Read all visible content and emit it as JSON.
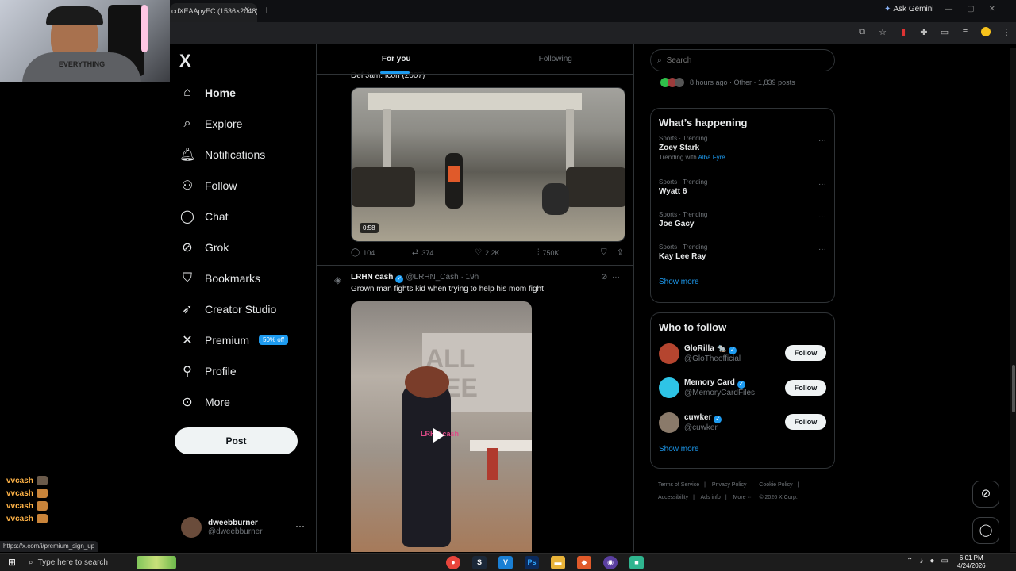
{
  "browser": {
    "tab_title": "cdXEAApyEC (1536×2048)",
    "tab_close": "×",
    "new_tab": "+",
    "ask_gemini": "Ask Gemini"
  },
  "webcam": {
    "shirt_text": "EVERYTHING"
  },
  "chat_overlay": {
    "lines": [
      "vvcash",
      "vvcash",
      "vvcash",
      "vvcash"
    ]
  },
  "status_url": "https://x.com/i/premium_sign_up",
  "nav": {
    "logo": "X",
    "items": [
      {
        "label": "Home",
        "icon": "home-icon"
      },
      {
        "label": "Explore",
        "icon": "search-icon"
      },
      {
        "label": "Notifications",
        "icon": "bell-icon"
      },
      {
        "label": "Follow",
        "icon": "add-person-icon"
      },
      {
        "label": "Chat",
        "icon": "chat-icon"
      },
      {
        "label": "Grok",
        "icon": "grok-icon"
      },
      {
        "label": "Bookmarks",
        "icon": "bookmark-icon"
      },
      {
        "label": "Creator Studio",
        "icon": "rocket-icon"
      },
      {
        "label": "Premium",
        "icon": "x-logo-icon"
      },
      {
        "label": "Profile",
        "icon": "person-icon"
      },
      {
        "label": "More",
        "icon": "more-circle-icon"
      }
    ],
    "premium_badge": "50% off",
    "post_button": "Post",
    "account": {
      "name": "dweebburner",
      "handle": "@dweebburner",
      "more": "···"
    }
  },
  "feed": {
    "tabs": [
      "For you",
      "Following"
    ],
    "prev_tweet_text": "Def Jam: Icon (2007)",
    "video_duration": "0:58",
    "actions": {
      "replies": "104",
      "reposts": "374",
      "likes": "2.2K",
      "views": "750K"
    },
    "tweet2": {
      "name": "LRHN cash",
      "handle": "@LRHN_Cash",
      "time": "· 19h",
      "text": "Grown man fights kid when trying to help his mom fight",
      "video_watermark": "LRHN cash",
      "wall_text": "ALL BEE"
    }
  },
  "sidebar": {
    "search_placeholder": "Search",
    "trend_meta": "8 hours ago · Other · 1,839 posts",
    "whats_happening": {
      "title": "What’s happening",
      "trends": [
        {
          "meta": "Sports · Trending",
          "topic": "Zoey Stark",
          "with_prefix": "Trending with",
          "with": "Alba Fyre"
        },
        {
          "meta": "Sports · Trending",
          "topic": "Wyatt 6"
        },
        {
          "meta": "Sports · Trending",
          "topic": "Joe Gacy"
        },
        {
          "meta": "Sports · Trending",
          "topic": "Kay Lee Ray"
        }
      ],
      "show_more": "Show more"
    },
    "who_to_follow": {
      "title": "Who to follow",
      "accounts": [
        {
          "name": "GloRilla 🐀",
          "handle": "@GloTheofficial",
          "avatar_color": "#b5452f"
        },
        {
          "name": "Memory Card",
          "handle": "@MemoryCardFiles",
          "avatar_color": "#2ec4e6"
        },
        {
          "name": "cuwker",
          "handle": "@cuwker",
          "avatar_color": "#8a7a6a"
        }
      ],
      "follow_label": "Follow",
      "show_more": "Show more"
    },
    "footer": [
      "Terms of Service",
      "|",
      "Privacy Policy",
      "|",
      "Cookie Policy",
      "|",
      "Accessibility",
      "|",
      "Ads info",
      "|",
      "More ···",
      "© 2026 X Corp."
    ]
  },
  "taskbar": {
    "search_text": "Type here to search",
    "time": "6:01 PM",
    "date": "4/24/2026",
    "apps": [
      {
        "name": "chrome-icon",
        "glyph": "●",
        "color": "#e8453c"
      },
      {
        "name": "steam-icon",
        "glyph": "S",
        "color": "#1b2838"
      },
      {
        "name": "vscode-icon",
        "glyph": "V",
        "color": "#1a7fd4"
      },
      {
        "name": "photoshop-icon",
        "glyph": "Ps",
        "color": "#0b2a5c"
      },
      {
        "name": "folder-icon",
        "glyph": "▬",
        "color": "#e8b339"
      },
      {
        "name": "shield-app-icon",
        "glyph": "◆",
        "color": "#e05a2a"
      },
      {
        "name": "obs-icon",
        "glyph": "◉",
        "color": "#5a3fa0"
      },
      {
        "name": "active-app-icon",
        "glyph": "■",
        "color": "#2fb58f"
      }
    ]
  },
  "colors": {
    "accent": "#1d9bf0",
    "background": "#000000",
    "text": "#e7e9ea",
    "muted": "#71767b"
  }
}
